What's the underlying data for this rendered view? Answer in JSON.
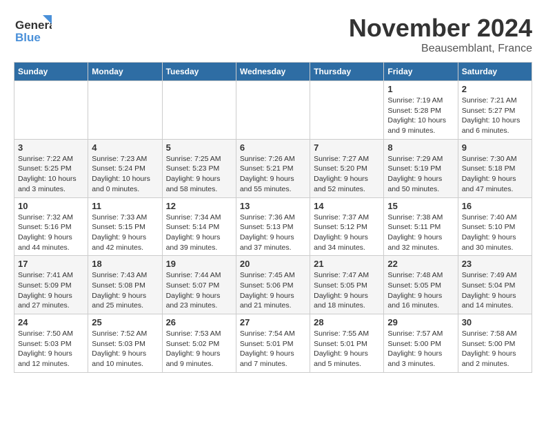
{
  "header": {
    "logo_line1": "General",
    "logo_line2": "Blue",
    "month_title": "November 2024",
    "location": "Beausemblant, France"
  },
  "weekdays": [
    "Sunday",
    "Monday",
    "Tuesday",
    "Wednesday",
    "Thursday",
    "Friday",
    "Saturday"
  ],
  "weeks": [
    [
      {
        "day": "",
        "info": ""
      },
      {
        "day": "",
        "info": ""
      },
      {
        "day": "",
        "info": ""
      },
      {
        "day": "",
        "info": ""
      },
      {
        "day": "",
        "info": ""
      },
      {
        "day": "1",
        "info": "Sunrise: 7:19 AM\nSunset: 5:28 PM\nDaylight: 10 hours and 9 minutes."
      },
      {
        "day": "2",
        "info": "Sunrise: 7:21 AM\nSunset: 5:27 PM\nDaylight: 10 hours and 6 minutes."
      }
    ],
    [
      {
        "day": "3",
        "info": "Sunrise: 7:22 AM\nSunset: 5:25 PM\nDaylight: 10 hours and 3 minutes."
      },
      {
        "day": "4",
        "info": "Sunrise: 7:23 AM\nSunset: 5:24 PM\nDaylight: 10 hours and 0 minutes."
      },
      {
        "day": "5",
        "info": "Sunrise: 7:25 AM\nSunset: 5:23 PM\nDaylight: 9 hours and 58 minutes."
      },
      {
        "day": "6",
        "info": "Sunrise: 7:26 AM\nSunset: 5:21 PM\nDaylight: 9 hours and 55 minutes."
      },
      {
        "day": "7",
        "info": "Sunrise: 7:27 AM\nSunset: 5:20 PM\nDaylight: 9 hours and 52 minutes."
      },
      {
        "day": "8",
        "info": "Sunrise: 7:29 AM\nSunset: 5:19 PM\nDaylight: 9 hours and 50 minutes."
      },
      {
        "day": "9",
        "info": "Sunrise: 7:30 AM\nSunset: 5:18 PM\nDaylight: 9 hours and 47 minutes."
      }
    ],
    [
      {
        "day": "10",
        "info": "Sunrise: 7:32 AM\nSunset: 5:16 PM\nDaylight: 9 hours and 44 minutes."
      },
      {
        "day": "11",
        "info": "Sunrise: 7:33 AM\nSunset: 5:15 PM\nDaylight: 9 hours and 42 minutes."
      },
      {
        "day": "12",
        "info": "Sunrise: 7:34 AM\nSunset: 5:14 PM\nDaylight: 9 hours and 39 minutes."
      },
      {
        "day": "13",
        "info": "Sunrise: 7:36 AM\nSunset: 5:13 PM\nDaylight: 9 hours and 37 minutes."
      },
      {
        "day": "14",
        "info": "Sunrise: 7:37 AM\nSunset: 5:12 PM\nDaylight: 9 hours and 34 minutes."
      },
      {
        "day": "15",
        "info": "Sunrise: 7:38 AM\nSunset: 5:11 PM\nDaylight: 9 hours and 32 minutes."
      },
      {
        "day": "16",
        "info": "Sunrise: 7:40 AM\nSunset: 5:10 PM\nDaylight: 9 hours and 30 minutes."
      }
    ],
    [
      {
        "day": "17",
        "info": "Sunrise: 7:41 AM\nSunset: 5:09 PM\nDaylight: 9 hours and 27 minutes."
      },
      {
        "day": "18",
        "info": "Sunrise: 7:43 AM\nSunset: 5:08 PM\nDaylight: 9 hours and 25 minutes."
      },
      {
        "day": "19",
        "info": "Sunrise: 7:44 AM\nSunset: 5:07 PM\nDaylight: 9 hours and 23 minutes."
      },
      {
        "day": "20",
        "info": "Sunrise: 7:45 AM\nSunset: 5:06 PM\nDaylight: 9 hours and 21 minutes."
      },
      {
        "day": "21",
        "info": "Sunrise: 7:47 AM\nSunset: 5:05 PM\nDaylight: 9 hours and 18 minutes."
      },
      {
        "day": "22",
        "info": "Sunrise: 7:48 AM\nSunset: 5:05 PM\nDaylight: 9 hours and 16 minutes."
      },
      {
        "day": "23",
        "info": "Sunrise: 7:49 AM\nSunset: 5:04 PM\nDaylight: 9 hours and 14 minutes."
      }
    ],
    [
      {
        "day": "24",
        "info": "Sunrise: 7:50 AM\nSunset: 5:03 PM\nDaylight: 9 hours and 12 minutes."
      },
      {
        "day": "25",
        "info": "Sunrise: 7:52 AM\nSunset: 5:03 PM\nDaylight: 9 hours and 10 minutes."
      },
      {
        "day": "26",
        "info": "Sunrise: 7:53 AM\nSunset: 5:02 PM\nDaylight: 9 hours and 9 minutes."
      },
      {
        "day": "27",
        "info": "Sunrise: 7:54 AM\nSunset: 5:01 PM\nDaylight: 9 hours and 7 minutes."
      },
      {
        "day": "28",
        "info": "Sunrise: 7:55 AM\nSunset: 5:01 PM\nDaylight: 9 hours and 5 minutes."
      },
      {
        "day": "29",
        "info": "Sunrise: 7:57 AM\nSunset: 5:00 PM\nDaylight: 9 hours and 3 minutes."
      },
      {
        "day": "30",
        "info": "Sunrise: 7:58 AM\nSunset: 5:00 PM\nDaylight: 9 hours and 2 minutes."
      }
    ]
  ]
}
